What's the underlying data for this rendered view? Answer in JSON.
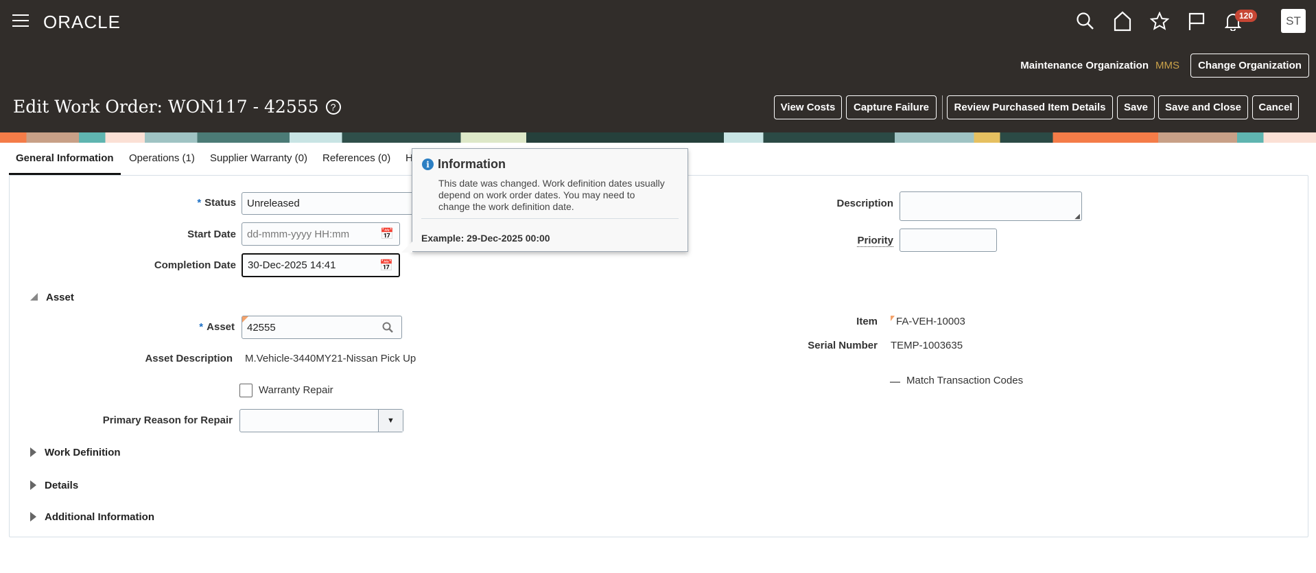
{
  "header": {
    "brand": "ORACLE",
    "notification_count": "120",
    "user_initials": "ST",
    "org_label": "Maintenance Organization",
    "org_value": "MMS",
    "change_org": "Change Organization"
  },
  "page": {
    "title": "Edit Work Order: WON117 - 42555",
    "buttons": {
      "view_costs": "View Costs",
      "capture_failure": "Capture Failure",
      "review": "Review Purchased Item Details",
      "save": "Save",
      "save_close": "Save and Close",
      "cancel": "Cancel"
    }
  },
  "tabs": [
    "General Information",
    "Operations (1)",
    "Supplier Warranty (0)",
    "References (0)",
    "H"
  ],
  "form": {
    "status_label": "Status",
    "status_value": "Unreleased",
    "start_label": "Start Date",
    "start_placeholder": "dd-mmm-yyyy HH:mm",
    "completion_label": "Completion Date",
    "completion_value": "30-Dec-2025 14:41",
    "description_label": "Description",
    "priority_label": "Priority"
  },
  "asset": {
    "section": "Asset",
    "asset_label": "Asset",
    "asset_value": "42555",
    "desc_label": "Asset Description",
    "desc_value": "M.Vehicle-3440MY21-Nissan Pick Up",
    "warranty_label": "Warranty Repair",
    "reason_label": "Primary Reason for Repair",
    "item_label": "Item",
    "item_value": "FA-VEH-10003",
    "serial_label": "Serial Number",
    "serial_value": "TEMP-1003635",
    "match_label": "Match Transaction Codes"
  },
  "sections": [
    "Work Definition",
    "Details",
    "Additional Information"
  ],
  "popup": {
    "title": "Information",
    "body": "This date was changed. Work definition dates usually depend on work order dates. You may need to change the work definition date.",
    "example": "Example: 29-Dec-2025 00:00"
  }
}
